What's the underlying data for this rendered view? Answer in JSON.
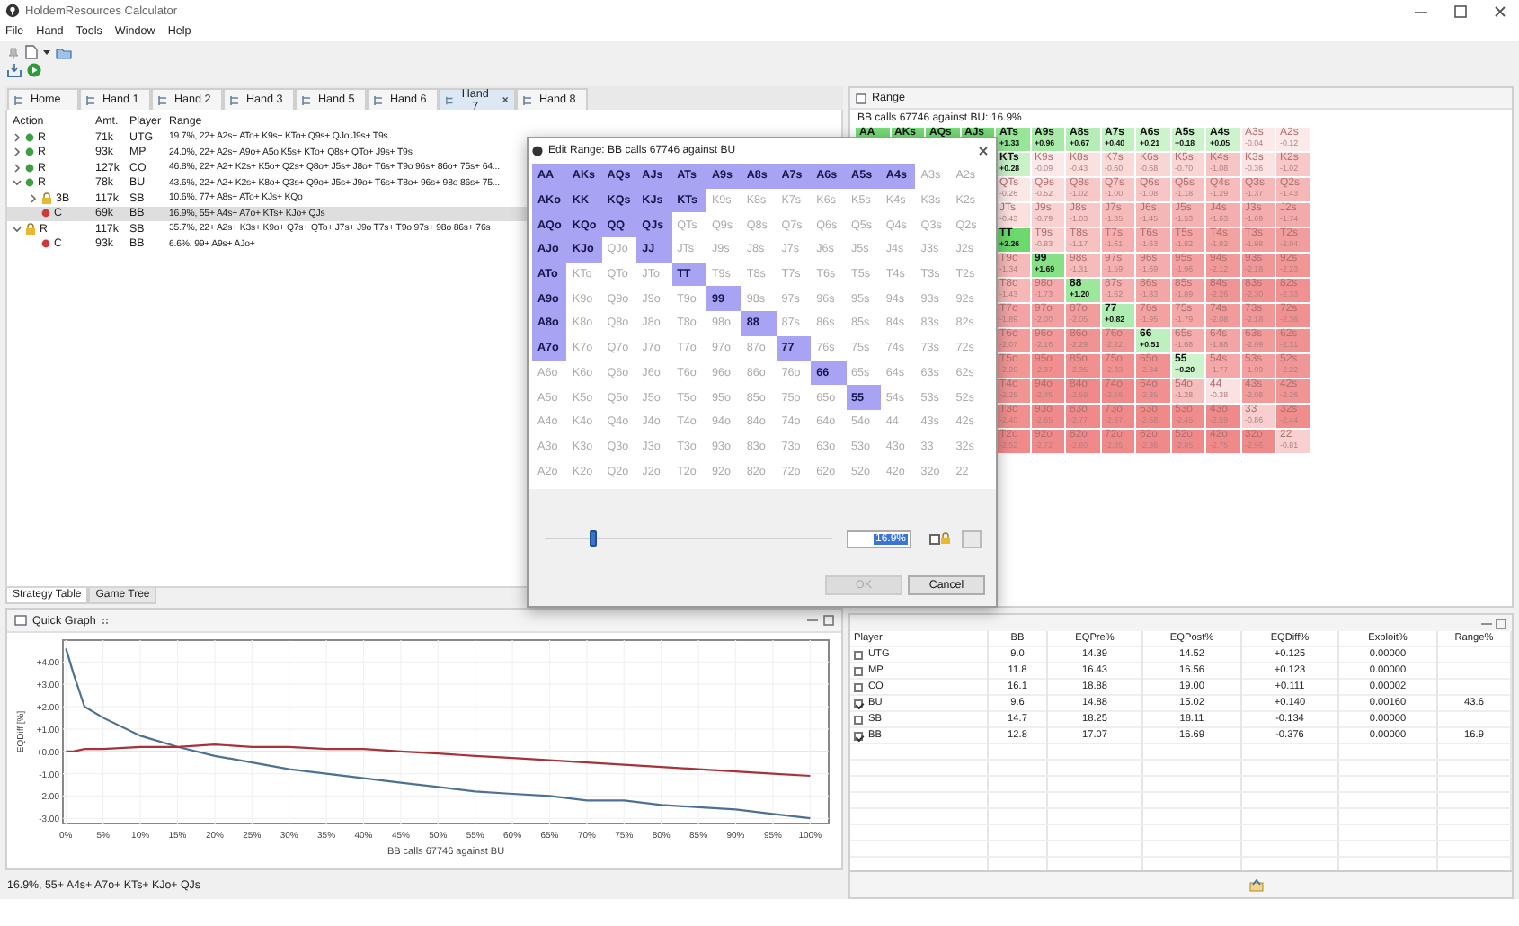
{
  "window": {
    "title": "HoldemResources Calculator"
  },
  "menu": [
    "File",
    "Hand",
    "Tools",
    "Window",
    "Help"
  ],
  "hand_tabs": [
    {
      "label": "Home",
      "selected": false,
      "closable": false
    },
    {
      "label": "Hand 1",
      "selected": false,
      "closable": false
    },
    {
      "label": "Hand 2",
      "selected": false,
      "closable": false
    },
    {
      "label": "Hand 3",
      "selected": false,
      "closable": false
    },
    {
      "label": "Hand 5",
      "selected": false,
      "closable": false
    },
    {
      "label": "Hand 6",
      "selected": false,
      "closable": false
    },
    {
      "label": "Hand 7",
      "selected": true,
      "closable": true
    },
    {
      "label": "Hand 8",
      "selected": false,
      "closable": false
    }
  ],
  "tree": {
    "columns": [
      "Action",
      "Amt.",
      "Player",
      "Range"
    ],
    "rows": [
      {
        "kind": "dot",
        "color": "#3f9e3f",
        "action": "R",
        "amount": "71k",
        "player": "UTG",
        "range": "19.7%, 22+ A2s+ ATo+ K9s+ KTo+ Q9s+ QJo J9s+ T9s",
        "expanded": false,
        "selected": false
      },
      {
        "kind": "dot",
        "color": "#3f9e3f",
        "action": "R",
        "amount": "93k",
        "player": "MP",
        "range": "24.0%, 22+ A2s+ A9o+ A5o K5s+ KTo+ Q8s+ QTo+ J9s+ T9s",
        "expanded": false,
        "selected": false
      },
      {
        "kind": "dot",
        "color": "#3f9e3f",
        "action": "R",
        "amount": "127k",
        "player": "CO",
        "range": "46.8%, 22+ A2+ K2s+ K5o+ Q2s+ Q8o+ J5s+ J8o+ T6s+ T9o 96s+ 86o+ 75s+ 64...",
        "expanded": false,
        "selected": false
      },
      {
        "kind": "dot",
        "color": "#3f9e3f",
        "action": "R",
        "amount": "78k",
        "player": "BU",
        "range": "43.6%, 22+ A2+ K2s+ K8o+ Q3s+ Q9o+ J5s+ J9o+ T6s+ T8o+ 96s+ 98o 86s+ 75...",
        "expanded": true,
        "selected": false,
        "children": [
          {
            "kind": "lock",
            "action": "3B",
            "amount": "117k",
            "player": "SB",
            "range": "10.6%, 77+ A8s+ ATo+ KJs+ KQo",
            "expanded": false,
            "selected": false
          },
          {
            "kind": "dot",
            "color": "#cc3b3b",
            "action": "C",
            "amount": "69k",
            "player": "BB",
            "range": "16.9%, 55+ A4s+ A7o+ KTs+ KJo+ QJs",
            "selected": true
          }
        ]
      },
      {
        "kind": "lock",
        "action": "R",
        "amount": "117k",
        "player": "SB",
        "range": "35.7%, 22+ A2s+ K3s+ K9o+ Q7s+ QTo+ J7s+ J9o T7s+ T9o 97s+ 98o 86s+ 76s",
        "expanded": true,
        "selected": false,
        "children": [
          {
            "kind": "dot",
            "color": "#cc3b3b",
            "action": "C",
            "amount": "93k",
            "player": "BB",
            "range": "6.6%, 99+ A9s+ AJo+",
            "selected": false
          }
        ]
      }
    ]
  },
  "view_tabs": [
    {
      "label": "Strategy Table",
      "selected": true
    },
    {
      "label": "Game Tree",
      "selected": false
    }
  ],
  "quick_graph": {
    "title": "Quick Graph",
    "chart_data": {
      "type": "line",
      "xlabel": "BB calls 67746 against BU",
      "ylabel": "EQDiff [%]",
      "x": [
        0,
        1,
        2.5,
        5,
        10,
        15,
        20,
        25,
        30,
        35,
        40,
        45,
        50,
        55,
        60,
        65,
        70,
        75,
        80,
        85,
        90,
        95,
        100
      ],
      "series": [
        {
          "color": "#4d7192",
          "values": [
            4.6,
            3.5,
            2.0,
            1.5,
            0.7,
            0.2,
            -0.2,
            -0.5,
            -0.8,
            -1.0,
            -1.2,
            -1.4,
            -1.6,
            -1.8,
            -1.9,
            -2.0,
            -2.2,
            -2.2,
            -2.4,
            -2.5,
            -2.6,
            -2.8,
            -3.0
          ]
        },
        {
          "color": "#a8323c",
          "values": [
            0,
            0,
            0.1,
            0.1,
            0.2,
            0.2,
            0.3,
            0.2,
            0.2,
            0.1,
            0.1,
            0,
            -0.1,
            -0.2,
            -0.3,
            -0.4,
            -0.5,
            -0.6,
            -0.7,
            -0.8,
            -0.9,
            -1.0,
            -1.1
          ]
        }
      ],
      "grid": true,
      "xlim": [
        -0.4,
        102.5
      ],
      "ylim": [
        -3.23,
        4.98
      ],
      "xticks": [
        {
          "value": 0,
          "label": "0%"
        },
        {
          "value": 5,
          "label": "5%"
        },
        {
          "value": 10,
          "label": "10%"
        },
        {
          "value": 15,
          "label": "15%"
        },
        {
          "value": 20,
          "label": "20%"
        },
        {
          "value": 25,
          "label": "25%"
        },
        {
          "value": 30,
          "label": "30%"
        },
        {
          "value": 35,
          "label": "35%"
        },
        {
          "value": 40,
          "label": "40%"
        },
        {
          "value": 45,
          "label": "45%"
        },
        {
          "value": 50,
          "label": "50%"
        },
        {
          "value": 55,
          "label": "55%"
        },
        {
          "value": 60,
          "label": "60%"
        },
        {
          "value": 65,
          "label": "65%"
        },
        {
          "value": 70,
          "label": "70%"
        },
        {
          "value": 75,
          "label": "75%"
        },
        {
          "value": 80,
          "label": "80%"
        },
        {
          "value": 85,
          "label": "85%"
        },
        {
          "value": 90,
          "label": "90%"
        },
        {
          "value": 95,
          "label": "95%"
        },
        {
          "value": 100,
          "label": "100%"
        }
      ],
      "yticks": [
        {
          "value": 4,
          "label": "+4.00"
        },
        {
          "value": 3,
          "label": "+3.00"
        },
        {
          "value": 2,
          "label": "+2.00"
        },
        {
          "value": 1,
          "label": "+1.00"
        },
        {
          "value": 0,
          "label": "+0.00"
        },
        {
          "value": -1,
          "label": "-1.00"
        },
        {
          "value": -2,
          "label": "-2.00"
        },
        {
          "value": -3,
          "label": "-3.00"
        }
      ]
    }
  },
  "status": "16.9%, 55+ A4s+ A7o+ KTs+ KJo+ QJs",
  "range_panel": {
    "title": "Range",
    "caption": "BB calls 67746 against BU: 16.9%",
    "rows": [
      {
        "cells": [
          {
            "label": "AA",
            "selected": true
          },
          {
            "label": "AKs",
            "selected": true
          },
          {
            "label": "AQs",
            "selected": true
          },
          {
            "label": "AJs",
            "selected": true
          },
          {
            "label": "ATs",
            "ev": "+1.33",
            "selected": true
          },
          {
            "label": "A9s",
            "ev": "+0.96",
            "selected": true
          },
          {
            "label": "A8s",
            "ev": "+0.67",
            "selected": true
          },
          {
            "label": "A7s",
            "ev": "+0.40",
            "selected": true
          },
          {
            "label": "A6s",
            "ev": "+0.21",
            "selected": true
          },
          {
            "label": "A5s",
            "ev": "+0.18",
            "selected": true
          },
          {
            "label": "A4s",
            "ev": "+0.05",
            "selected": true
          },
          {
            "label": "A3s",
            "ev": "-0.04",
            "selected": false
          },
          {
            "label": "A2s",
            "ev": "-0.12",
            "selected": false
          }
        ]
      },
      {
        "cells": [
          "",
          "",
          "",
          "",
          {
            "label": "KTs",
            "ev": "+0.28",
            "selected": true
          },
          {
            "label": "K9s",
            "ev": "-0.09",
            "selected": false
          },
          {
            "label": "K8s",
            "ev": "-0.43",
            "selected": false
          },
          {
            "label": "K7s",
            "ev": "-0.60",
            "selected": false
          },
          {
            "label": "K6s",
            "ev": "-0.68",
            "selected": false
          },
          {
            "label": "K5s",
            "ev": "-0.70",
            "selected": false
          },
          {
            "label": "K4s",
            "ev": "-1.08",
            "selected": false
          },
          {
            "label": "K3s",
            "ev": "-0.36",
            "selected": false
          },
          {
            "label": "K2s",
            "ev": "-1.02",
            "selected": false
          }
        ]
      },
      {
        "cells": [
          "",
          "",
          "",
          "",
          {
            "label": "QTs",
            "ev": "-0.26",
            "selected": false
          },
          {
            "label": "Q9s",
            "ev": "-0.52",
            "selected": false
          },
          {
            "label": "Q8s",
            "ev": "-1.02",
            "selected": false
          },
          {
            "label": "Q7s",
            "ev": "-1.00",
            "selected": false
          },
          {
            "label": "Q6s",
            "ev": "-1.08",
            "selected": false
          },
          {
            "label": "Q5s",
            "ev": "-1.18",
            "selected": false
          },
          {
            "label": "Q4s",
            "ev": "-1.29",
            "selected": false
          },
          {
            "label": "Q3s",
            "ev": "-1.37",
            "selected": false
          },
          {
            "label": "Q2s",
            "ev": "-1.43",
            "selected": false
          }
        ]
      },
      {
        "cells": [
          "",
          "",
          "",
          "",
          {
            "label": "JTs",
            "ev": "-0.43",
            "selected": false
          },
          {
            "label": "J9s",
            "ev": "-0.79",
            "selected": false
          },
          {
            "label": "J8s",
            "ev": "-1.03",
            "selected": false
          },
          {
            "label": "J7s",
            "ev": "-1.35",
            "selected": false
          },
          {
            "label": "J6s",
            "ev": "-1.45",
            "selected": false
          },
          {
            "label": "J5s",
            "ev": "-1.53",
            "selected": false
          },
          {
            "label": "J4s",
            "ev": "-1.63",
            "selected": false
          },
          {
            "label": "J3s",
            "ev": "-1.69",
            "selected": false
          },
          {
            "label": "J2s",
            "ev": "-1.74",
            "selected": false
          }
        ]
      },
      {
        "cells": [
          "",
          "",
          "",
          "",
          {
            "label": "TT",
            "ev": "+2.26",
            "selected": true
          },
          {
            "label": "T9s",
            "ev": "-0.83",
            "selected": false
          },
          {
            "label": "T8s",
            "ev": "-1.17",
            "selected": false
          },
          {
            "label": "T7s",
            "ev": "-1.61",
            "selected": false
          },
          {
            "label": "T6s",
            "ev": "-1.63",
            "selected": false
          },
          {
            "label": "T5s",
            "ev": "-1.82",
            "selected": false
          },
          {
            "label": "T4s",
            "ev": "-1.92",
            "selected": false
          },
          {
            "label": "T3s",
            "ev": "-1.98",
            "selected": false
          },
          {
            "label": "T2s",
            "ev": "-2.04",
            "selected": false
          }
        ]
      },
      {
        "cells": [
          "",
          "",
          "",
          "",
          {
            "label": "T9o",
            "ev": "-1.34",
            "selected": false
          },
          {
            "label": "99",
            "ev": "+1.69",
            "selected": true
          },
          {
            "label": "98s",
            "ev": "-1.31",
            "selected": false
          },
          {
            "label": "97s",
            "ev": "-1.59",
            "selected": false
          },
          {
            "label": "96s",
            "ev": "-1.69",
            "selected": false
          },
          {
            "label": "95s",
            "ev": "-1.96",
            "selected": false
          },
          {
            "label": "94s",
            "ev": "-2.12",
            "selected": false
          },
          {
            "label": "93s",
            "ev": "-2.18",
            "selected": false
          },
          {
            "label": "92s",
            "ev": "-2.23",
            "selected": false
          }
        ]
      },
      {
        "cells": [
          "",
          "",
          "",
          "",
          {
            "label": "T8o",
            "ev": "-1.43",
            "selected": false
          },
          {
            "label": "98o",
            "ev": "-1.73",
            "selected": false
          },
          {
            "label": "88",
            "ev": "+1.20",
            "selected": true
          },
          {
            "label": "87s",
            "ev": "-1.62",
            "selected": false
          },
          {
            "label": "86s",
            "ev": "-1.83",
            "selected": false
          },
          {
            "label": "85s",
            "ev": "-1.89",
            "selected": false
          },
          {
            "label": "84s",
            "ev": "-2.26",
            "selected": false
          },
          {
            "label": "83s",
            "ev": "-2.30",
            "selected": false
          },
          {
            "label": "82s",
            "ev": "-2.33",
            "selected": false
          }
        ]
      },
      {
        "cells": [
          "",
          "",
          "",
          "",
          {
            "label": "T7o",
            "ev": "-1.89",
            "selected": false
          },
          {
            "label": "97o",
            "ev": "-2.00",
            "selected": false
          },
          {
            "label": "87o",
            "ev": "-2.05",
            "selected": false
          },
          {
            "label": "77",
            "ev": "+0.82",
            "selected": true
          },
          {
            "label": "76s",
            "ev": "-1.95",
            "selected": false
          },
          {
            "label": "75s",
            "ev": "-1.79",
            "selected": false
          },
          {
            "label": "74s",
            "ev": "-2.08",
            "selected": false
          },
          {
            "label": "73s",
            "ev": "-2.18",
            "selected": false
          },
          {
            "label": "72s",
            "ev": "-2.36",
            "selected": false
          }
        ]
      },
      {
        "cells": [
          "",
          "",
          "",
          "",
          {
            "label": "T6o",
            "ev": "-2.07",
            "selected": false
          },
          {
            "label": "96o",
            "ev": "-2.16",
            "selected": false
          },
          {
            "label": "86o",
            "ev": "-2.29",
            "selected": false
          },
          {
            "label": "76o",
            "ev": "-2.22",
            "selected": false
          },
          {
            "label": "66",
            "ev": "+0.51",
            "selected": true
          },
          {
            "label": "65s",
            "ev": "-1.68",
            "selected": false
          },
          {
            "label": "64s",
            "ev": "-1.88",
            "selected": false
          },
          {
            "label": "63s",
            "ev": "-2.09",
            "selected": false
          },
          {
            "label": "62s",
            "ev": "-2.31",
            "selected": false
          }
        ]
      },
      {
        "cells": [
          "",
          "",
          "",
          "",
          {
            "label": "T5o",
            "ev": "-2.20",
            "selected": false
          },
          {
            "label": "95o",
            "ev": "-2.37",
            "selected": false
          },
          {
            "label": "85o",
            "ev": "-2.35",
            "selected": false
          },
          {
            "label": "75o",
            "ev": "-2.33",
            "selected": false
          },
          {
            "label": "65o",
            "ev": "-2.34",
            "selected": false
          },
          {
            "label": "55",
            "ev": "+0.20",
            "selected": true
          },
          {
            "label": "54s",
            "ev": "-1.77",
            "selected": false
          },
          {
            "label": "53s",
            "ev": "-1.99",
            "selected": false
          },
          {
            "label": "52s",
            "ev": "-2.22",
            "selected": false
          }
        ]
      },
      {
        "cells": [
          "",
          "",
          "",
          "",
          {
            "label": "T4o",
            "ev": "-2.25",
            "selected": false
          },
          {
            "label": "94o",
            "ev": "-2.45",
            "selected": false
          },
          {
            "label": "84o",
            "ev": "-2.59",
            "selected": false
          },
          {
            "label": "74o",
            "ev": "-2.56",
            "selected": false
          },
          {
            "label": "64o",
            "ev": "-2.35",
            "selected": false
          },
          {
            "label": "54o",
            "ev": "-1.28",
            "selected": false
          },
          {
            "label": "44",
            "ev": "-0.38",
            "selected": false
          },
          {
            "label": "43s",
            "ev": "-2.08",
            "selected": false
          },
          {
            "label": "42s",
            "ev": "-2.26",
            "selected": false
          }
        ]
      },
      {
        "cells": [
          "",
          "",
          "",
          "",
          {
            "label": "T3o",
            "ev": "-2.40",
            "selected": false
          },
          {
            "label": "93o",
            "ev": "-2.65",
            "selected": false
          },
          {
            "label": "83o",
            "ev": "-2.77",
            "selected": false
          },
          {
            "label": "73o",
            "ev": "-2.67",
            "selected": false
          },
          {
            "label": "63o",
            "ev": "-2.68",
            "selected": false
          },
          {
            "label": "53o",
            "ev": "-2.45",
            "selected": false
          },
          {
            "label": "43o",
            "ev": "-2.59",
            "selected": false
          },
          {
            "label": "33",
            "ev": "-0.86",
            "selected": false
          },
          {
            "label": "32s",
            "ev": "-2.44",
            "selected": false
          }
        ]
      },
      {
        "cells": [
          "",
          "",
          "",
          "",
          {
            "label": "T2o",
            "ev": "-2.52",
            "selected": false
          },
          {
            "label": "92o",
            "ev": "-2.72",
            "selected": false
          },
          {
            "label": "82o",
            "ev": "-2.80",
            "selected": false
          },
          {
            "label": "72o",
            "ev": "-2.85",
            "selected": false
          },
          {
            "label": "62o",
            "ev": "-2.86",
            "selected": false
          },
          {
            "label": "52o",
            "ev": "-2.85",
            "selected": false
          },
          {
            "label": "42o",
            "ev": "-2.75",
            "selected": false
          },
          {
            "label": "32o",
            "ev": "-2.96",
            "selected": false
          },
          {
            "label": "22",
            "ev": "-0.81",
            "selected": false
          }
        ]
      }
    ]
  },
  "stats": {
    "columns": [
      "Player",
      "BB",
      "EQPre%",
      "EQPost%",
      "EQDiff%",
      "Exploit%",
      "Range%"
    ],
    "rows": [
      {
        "player": "UTG",
        "checked": false,
        "bb": "9.0",
        "eq_pre": "14.39",
        "eq_post": "14.52",
        "eq_diff": "+0.125",
        "exploit": "0.00000"
      },
      {
        "player": "MP",
        "checked": false,
        "bb": "11.8",
        "eq_pre": "16.43",
        "eq_post": "16.56",
        "eq_diff": "+0.123",
        "exploit": "0.00000"
      },
      {
        "player": "CO",
        "checked": false,
        "bb": "16.1",
        "eq_pre": "18.88",
        "eq_post": "19.00",
        "eq_diff": "+0.111",
        "exploit": "0.00002"
      },
      {
        "player": "BU",
        "checked": true,
        "bb": "9.6",
        "eq_pre": "14.88",
        "eq_post": "15.02",
        "eq_diff": "+0.140",
        "exploit": "0.00160",
        "range": "43.6"
      },
      {
        "player": "SB",
        "checked": false,
        "bb": "14.7",
        "eq_pre": "18.25",
        "eq_post": "18.11",
        "eq_diff": "-0.134",
        "exploit": "0.00000"
      },
      {
        "player": "BB",
        "checked": true,
        "bb": "12.8",
        "eq_pre": "17.07",
        "eq_post": "16.69",
        "eq_diff": "-0.376",
        "exploit": "0.00000",
        "range": "16.9"
      }
    ]
  },
  "dialog": {
    "title": "Edit Range: BB calls 67746 against BU",
    "grid": [
      {
        "cells": [
          {
            "label": "AA",
            "selected": true
          },
          {
            "label": "AKs",
            "selected": true
          },
          {
            "label": "AQs",
            "selected": true
          },
          {
            "label": "AJs",
            "selected": true
          },
          {
            "label": "ATs",
            "selected": true
          },
          {
            "label": "A9s",
            "selected": true
          },
          {
            "label": "A8s",
            "selected": true
          },
          {
            "label": "A7s",
            "selected": true
          },
          {
            "label": "A6s",
            "selected": true
          },
          {
            "label": "A5s",
            "selected": true
          },
          {
            "label": "A4s",
            "selected": true
          },
          {
            "label": "A3s",
            "selected": false
          },
          {
            "label": "A2s",
            "selected": false
          }
        ]
      },
      {
        "cells": [
          {
            "label": "AKo",
            "selected": true
          },
          {
            "label": "KK",
            "selected": true
          },
          {
            "label": "KQs",
            "selected": true
          },
          {
            "label": "KJs",
            "selected": true
          },
          {
            "label": "KTs",
            "selected": true
          },
          {
            "label": "K9s",
            "selected": false
          },
          {
            "label": "K8s",
            "selected": false
          },
          {
            "label": "K7s",
            "selected": false
          },
          {
            "label": "K6s",
            "selected": false
          },
          {
            "label": "K5s",
            "selected": false
          },
          {
            "label": "K4s",
            "selected": false
          },
          {
            "label": "K3s",
            "selected": false
          },
          {
            "label": "K2s",
            "selected": false
          }
        ]
      },
      {
        "cells": [
          {
            "label": "AQo",
            "selected": true
          },
          {
            "label": "KQo",
            "selected": true
          },
          {
            "label": "QQ",
            "selected": true
          },
          {
            "label": "QJs",
            "selected": true
          },
          {
            "label": "QTs",
            "selected": false
          },
          {
            "label": "Q9s",
            "selected": false
          },
          {
            "label": "Q8s",
            "selected": false
          },
          {
            "label": "Q7s",
            "selected": false
          },
          {
            "label": "Q6s",
            "selected": false
          },
          {
            "label": "Q5s",
            "selected": false
          },
          {
            "label": "Q4s",
            "selected": false
          },
          {
            "label": "Q3s",
            "selected": false
          },
          {
            "label": "Q2s",
            "selected": false
          }
        ]
      },
      {
        "cells": [
          {
            "label": "AJo",
            "selected": true
          },
          {
            "label": "KJo",
            "selected": true
          },
          {
            "label": "QJo",
            "selected": false
          },
          {
            "label": "JJ",
            "selected": true
          },
          {
            "label": "JTs",
            "selected": false
          },
          {
            "label": "J9s",
            "selected": false
          },
          {
            "label": "J8s",
            "selected": false
          },
          {
            "label": "J7s",
            "selected": false
          },
          {
            "label": "J6s",
            "selected": false
          },
          {
            "label": "J5s",
            "selected": false
          },
          {
            "label": "J4s",
            "selected": false
          },
          {
            "label": "J3s",
            "selected": false
          },
          {
            "label": "J2s",
            "selected": false
          }
        ]
      },
      {
        "cells": [
          {
            "label": "ATo",
            "selected": true
          },
          {
            "label": "KTo",
            "selected": false
          },
          {
            "label": "QTo",
            "selected": false
          },
          {
            "label": "JTo",
            "selected": false
          },
          {
            "label": "TT",
            "selected": true
          },
          {
            "label": "T9s",
            "selected": false
          },
          {
            "label": "T8s",
            "selected": false
          },
          {
            "label": "T7s",
            "selected": false
          },
          {
            "label": "T6s",
            "selected": false
          },
          {
            "label": "T5s",
            "selected": false
          },
          {
            "label": "T4s",
            "selected": false
          },
          {
            "label": "T3s",
            "selected": false
          },
          {
            "label": "T2s",
            "selected": false
          }
        ]
      },
      {
        "cells": [
          {
            "label": "A9o",
            "selected": true
          },
          {
            "label": "K9o",
            "selected": false
          },
          {
            "label": "Q9o",
            "selected": false
          },
          {
            "label": "J9o",
            "selected": false
          },
          {
            "label": "T9o",
            "selected": false
          },
          {
            "label": "99",
            "selected": true
          },
          {
            "label": "98s",
            "selected": false
          },
          {
            "label": "97s",
            "selected": false
          },
          {
            "label": "96s",
            "selected": false
          },
          {
            "label": "95s",
            "selected": false
          },
          {
            "label": "94s",
            "selected": false
          },
          {
            "label": "93s",
            "selected": false
          },
          {
            "label": "92s",
            "selected": false
          }
        ]
      },
      {
        "cells": [
          {
            "label": "A8o",
            "selected": true
          },
          {
            "label": "K8o",
            "selected": false
          },
          {
            "label": "Q8o",
            "selected": false
          },
          {
            "label": "J8o",
            "selected": false
          },
          {
            "label": "T8o",
            "selected": false
          },
          {
            "label": "98o",
            "selected": false
          },
          {
            "label": "88",
            "selected": true
          },
          {
            "label": "87s",
            "selected": false
          },
          {
            "label": "86s",
            "selected": false
          },
          {
            "label": "85s",
            "selected": false
          },
          {
            "label": "84s",
            "selected": false
          },
          {
            "label": "83s",
            "selected": false
          },
          {
            "label": "82s",
            "selected": false
          }
        ]
      },
      {
        "cells": [
          {
            "label": "A7o",
            "selected": true
          },
          {
            "label": "K7o",
            "selected": false
          },
          {
            "label": "Q7o",
            "selected": false
          },
          {
            "label": "J7o",
            "selected": false
          },
          {
            "label": "T7o",
            "selected": false
          },
          {
            "label": "97o",
            "selected": false
          },
          {
            "label": "87o",
            "selected": false
          },
          {
            "label": "77",
            "selected": true
          },
          {
            "label": "76s",
            "selected": false
          },
          {
            "label": "75s",
            "selected": false
          },
          {
            "label": "74s",
            "selected": false
          },
          {
            "label": "73s",
            "selected": false
          },
          {
            "label": "72s",
            "selected": false
          }
        ]
      },
      {
        "cells": [
          {
            "label": "A6o",
            "selected": false
          },
          {
            "label": "K6o",
            "selected": false
          },
          {
            "label": "Q6o",
            "selected": false
          },
          {
            "label": "J6o",
            "selected": false
          },
          {
            "label": "T6o",
            "selected": false
          },
          {
            "label": "96o",
            "selected": false
          },
          {
            "label": "86o",
            "selected": false
          },
          {
            "label": "76o",
            "selected": false
          },
          {
            "label": "66",
            "selected": true
          },
          {
            "label": "65s",
            "selected": false
          },
          {
            "label": "64s",
            "selected": false
          },
          {
            "label": "63s",
            "selected": false
          },
          {
            "label": "62s",
            "selected": false
          }
        ]
      },
      {
        "cells": [
          {
            "label": "A5o",
            "selected": false
          },
          {
            "label": "K5o",
            "selected": false
          },
          {
            "label": "Q5o",
            "selected": false
          },
          {
            "label": "J5o",
            "selected": false
          },
          {
            "label": "T5o",
            "selected": false
          },
          {
            "label": "95o",
            "selected": false
          },
          {
            "label": "85o",
            "selected": false
          },
          {
            "label": "75o",
            "selected": false
          },
          {
            "label": "65o",
            "selected": false
          },
          {
            "label": "55",
            "selected": true
          },
          {
            "label": "54s",
            "selected": false
          },
          {
            "label": "53s",
            "selected": false
          },
          {
            "label": "52s",
            "selected": false
          }
        ]
      },
      {
        "cells": [
          {
            "label": "A4o",
            "selected": false
          },
          {
            "label": "K4o",
            "selected": false
          },
          {
            "label": "Q4o",
            "selected": false
          },
          {
            "label": "J4o",
            "selected": false
          },
          {
            "label": "T4o",
            "selected": false
          },
          {
            "label": "94o",
            "selected": false
          },
          {
            "label": "84o",
            "selected": false
          },
          {
            "label": "74o",
            "selected": false
          },
          {
            "label": "64o",
            "selected": false
          },
          {
            "label": "54o",
            "selected": false
          },
          {
            "label": "44",
            "selected": false
          },
          {
            "label": "43s",
            "selected": false
          },
          {
            "label": "42s",
            "selected": false
          }
        ]
      },
      {
        "cells": [
          {
            "label": "A3o",
            "selected": false
          },
          {
            "label": "K3o",
            "selected": false
          },
          {
            "label": "Q3o",
            "selected": false
          },
          {
            "label": "J3o",
            "selected": false
          },
          {
            "label": "T3o",
            "selected": false
          },
          {
            "label": "93o",
            "selected": false
          },
          {
            "label": "83o",
            "selected": false
          },
          {
            "label": "73o",
            "selected": false
          },
          {
            "label": "63o",
            "selected": false
          },
          {
            "label": "53o",
            "selected": false
          },
          {
            "label": "43o",
            "selected": false
          },
          {
            "label": "33",
            "selected": false
          },
          {
            "label": "32s",
            "selected": false
          }
        ]
      },
      {
        "cells": [
          {
            "label": "A2o",
            "selected": false
          },
          {
            "label": "K2o",
            "selected": false
          },
          {
            "label": "Q2o",
            "selected": false
          },
          {
            "label": "J2o",
            "selected": false
          },
          {
            "label": "T2o",
            "selected": false
          },
          {
            "label": "92o",
            "selected": false
          },
          {
            "label": "82o",
            "selected": false
          },
          {
            "label": "72o",
            "selected": false
          },
          {
            "label": "62o",
            "selected": false
          },
          {
            "label": "52o",
            "selected": false
          },
          {
            "label": "42o",
            "selected": false
          },
          {
            "label": "32o",
            "selected": false
          },
          {
            "label": "22",
            "selected": false
          }
        ]
      }
    ],
    "slider": {
      "level": 0.169
    },
    "percent": "16.9%",
    "lock_checked": false,
    "buttons": [
      {
        "label": "OK",
        "disabled": true
      },
      {
        "label": "Cancel",
        "disabled": false
      }
    ]
  }
}
